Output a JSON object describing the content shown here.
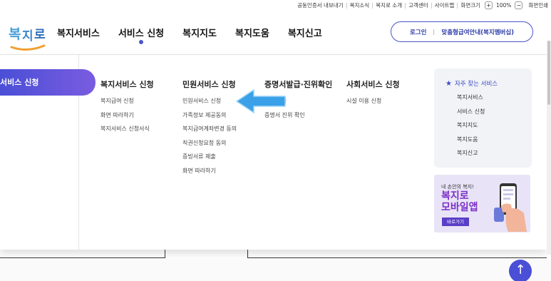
{
  "utility": {
    "links": [
      "공동인증서 내보내기",
      "복지소식",
      "복지로 소개",
      "고객센터",
      "사이트맵"
    ],
    "font_size_label": "화면크기",
    "zoom_in": "+",
    "zoom_value": "100%",
    "zoom_out": "−",
    "print_label": "화면인쇄"
  },
  "logo": {
    "text": "복지로"
  },
  "gnb": {
    "items": [
      "복지서비스",
      "서비스 신청",
      "복지지도",
      "복지도움",
      "복지신고"
    ],
    "active_index": 1
  },
  "login": {
    "login_label": "로그인",
    "benefit_label": "맞춤형급여안내(복지멤버십)"
  },
  "menu": {
    "active_tab": "서비스 신청",
    "columns": [
      {
        "title": "복지서비스 신청",
        "items": [
          "복지급여 신청",
          "화면 따라하기",
          "복지서비스 신청서식"
        ]
      },
      {
        "title": "민원서비스 신청",
        "items": [
          "민원서비스 신청",
          "가족정보 제공동의",
          "복지급여계좌변경 동의",
          "직권신청요청 동의",
          "증빙서류 제출",
          "화면 따라하기"
        ]
      },
      {
        "title": "증명서발급·진위확인",
        "items": [
          "서발급",
          "증명서 진위 확인"
        ]
      },
      {
        "title": "사회서비스 신청",
        "items": [
          "시설 이용 신청"
        ]
      }
    ]
  },
  "favorites": {
    "title": "자주 찾는 서비스",
    "items": [
      "복지서비스",
      "서비스 신청",
      "복지지도",
      "복지도움",
      "복지신고"
    ]
  },
  "banner": {
    "small": "내 손안의 복지!",
    "big_line1": "복지로",
    "big_line2": "모바일앱",
    "button": "바로가기"
  },
  "scroll_top": "↑",
  "colors": {
    "primary": "#4a56c8",
    "gradient_start": "#4a4fd6",
    "gradient_end": "#7a5ce0",
    "arrow": "#3aa0e8"
  }
}
